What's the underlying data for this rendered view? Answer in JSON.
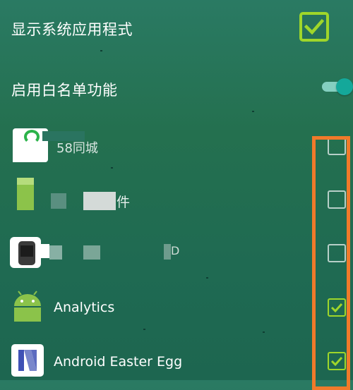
{
  "settings": {
    "show_system_apps_label": "显示系统应用程式",
    "show_system_apps_checked": true,
    "whitelist_label": "启用白名单功能",
    "whitelist_enabled": true
  },
  "apps": [
    {
      "name": "58同城",
      "checked": false,
      "icon": "58-city-icon"
    },
    {
      "name": "件",
      "checked": false,
      "icon": "green-app-icon"
    },
    {
      "name": "D",
      "checked": false,
      "icon": "watch-app-icon"
    },
    {
      "name": "Analytics",
      "checked": true,
      "icon": "android-robot-icon"
    },
    {
      "name": "Android Easter Egg",
      "checked": true,
      "icon": "android-n-logo-icon"
    }
  ],
  "colors": {
    "background": "#26715a",
    "accent_green": "#9fd62a",
    "toggle_thumb": "#14a89a",
    "highlight_box": "#f07a2a"
  }
}
